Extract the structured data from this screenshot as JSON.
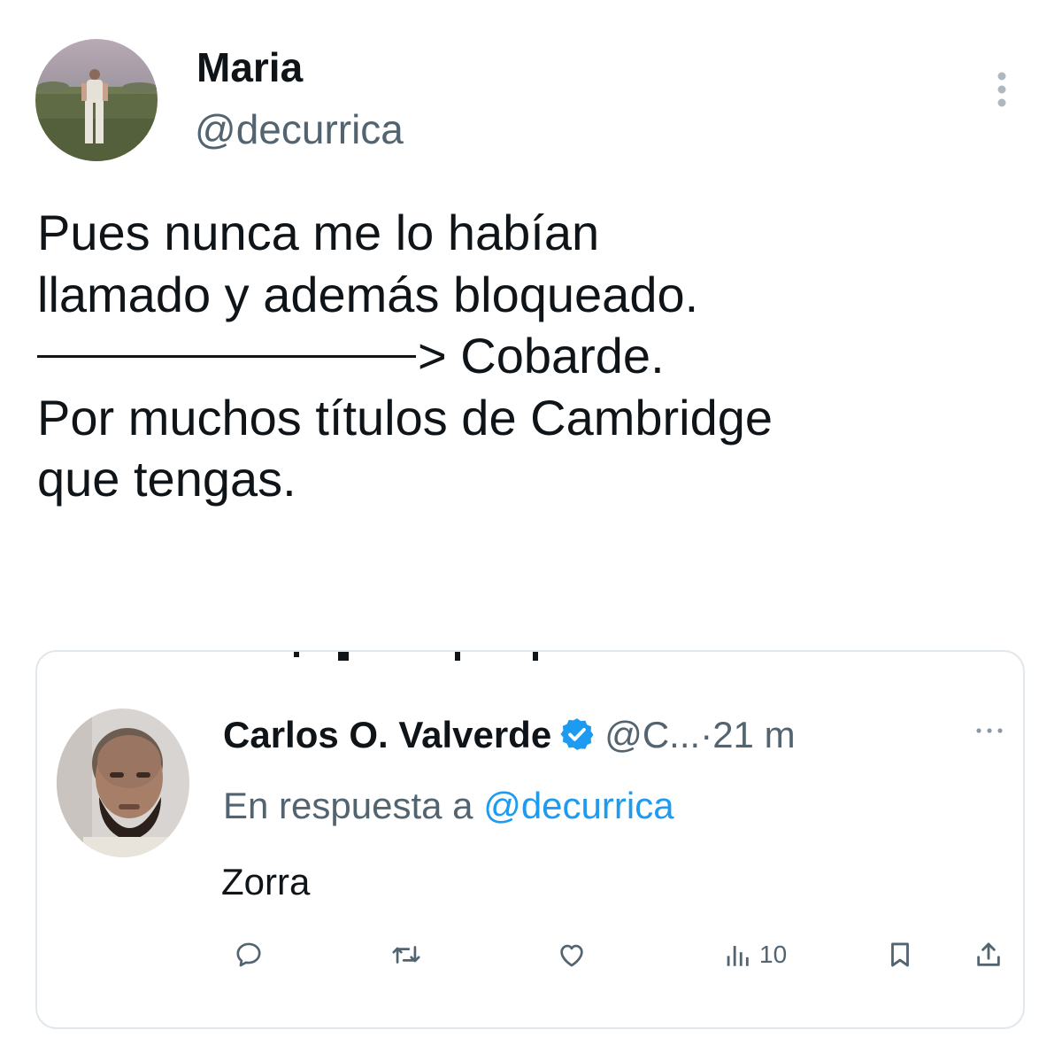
{
  "tweet": {
    "author": {
      "display_name": "Maria",
      "handle": "@decurrica"
    },
    "lines": [
      "Pues nunca me lo habían",
      "llamado y además bloqueado.",
      "> Cobarde.",
      "Por muchos títulos de Cambridge",
      "que tengas."
    ],
    "icons": {
      "more": "more-vertical-icon"
    }
  },
  "quoted_tweet": {
    "author": {
      "display_name": "Carlos O. Valverde",
      "handle_truncated": "@C...",
      "separator": "·",
      "time": "21 m"
    },
    "reply_prefix": "En respuesta a",
    "reply_mention": "@decurrica",
    "text": "Zorra",
    "actions": {
      "views_count": "10"
    },
    "icons": {
      "verified": "verified-badge-icon",
      "more": "more-horizontal-icon",
      "reply": "reply-icon",
      "retweet": "retweet-icon",
      "like": "heart-icon",
      "views": "views-icon",
      "bookmark": "bookmark-icon",
      "share": "share-icon"
    }
  },
  "colors": {
    "text": "#0f1419",
    "secondary": "#536471",
    "link": "#1d9bf0",
    "border": "#e1e8ed"
  }
}
